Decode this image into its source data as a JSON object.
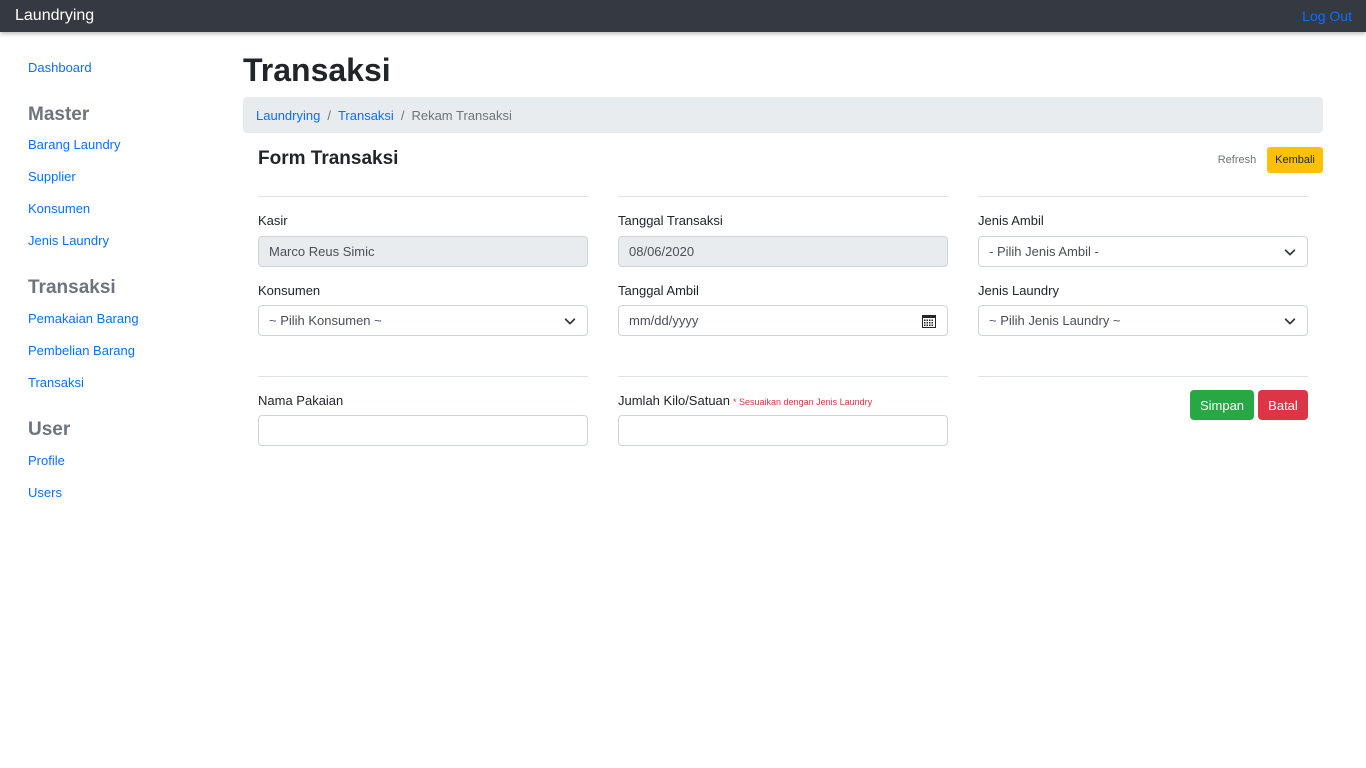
{
  "navbar": {
    "brand": "Laundrying",
    "logout": "Log Out"
  },
  "sidebar": {
    "dashboard": "Dashboard",
    "sections": [
      {
        "heading": "Master",
        "items": [
          "Barang Laundry",
          "Supplier",
          "Konsumen",
          "Jenis Laundry"
        ]
      },
      {
        "heading": "Transaksi",
        "items": [
          "Pemakaian Barang",
          "Pembelian Barang",
          "Transaksi"
        ]
      },
      {
        "heading": "User",
        "items": [
          "Profile",
          "Users"
        ]
      }
    ]
  },
  "page": {
    "title": "Transaksi"
  },
  "breadcrumb": {
    "items": [
      "Laundrying",
      "Transaksi",
      "Rekam Transaksi"
    ],
    "separator": "/"
  },
  "card": {
    "title": "Form Transaksi",
    "refresh": "Refresh",
    "back": "Kembali"
  },
  "form": {
    "kasir": {
      "label": "Kasir",
      "value": "Marco Reus Simic"
    },
    "tanggal_transaksi": {
      "label": "Tanggal Transaksi",
      "value": "08/06/2020"
    },
    "jenis_ambil": {
      "label": "Jenis Ambil",
      "value": "- Pilih Jenis Ambil -"
    },
    "konsumen": {
      "label": "Konsumen",
      "value": "~ Pilih Konsumen ~"
    },
    "tanggal_ambil": {
      "label": "Tanggal Ambil",
      "placeholder": "mm/dd/yyyy"
    },
    "jenis_laundry": {
      "label": "Jenis Laundry",
      "value": "~ Pilih Jenis Laundry ~"
    },
    "nama_pakaian": {
      "label": "Nama Pakaian",
      "value": ""
    },
    "jumlah": {
      "label": "Jumlah Kilo/Satuan",
      "note": "* Sesuaikan dengan Jenis Laundry",
      "value": ""
    },
    "save": "Simpan",
    "cancel": "Batal"
  },
  "colors": {
    "primary": "#0d6efd",
    "warning": "#ffc107",
    "success": "#28a745",
    "danger": "#dc3545",
    "navbar": "#343a40"
  }
}
